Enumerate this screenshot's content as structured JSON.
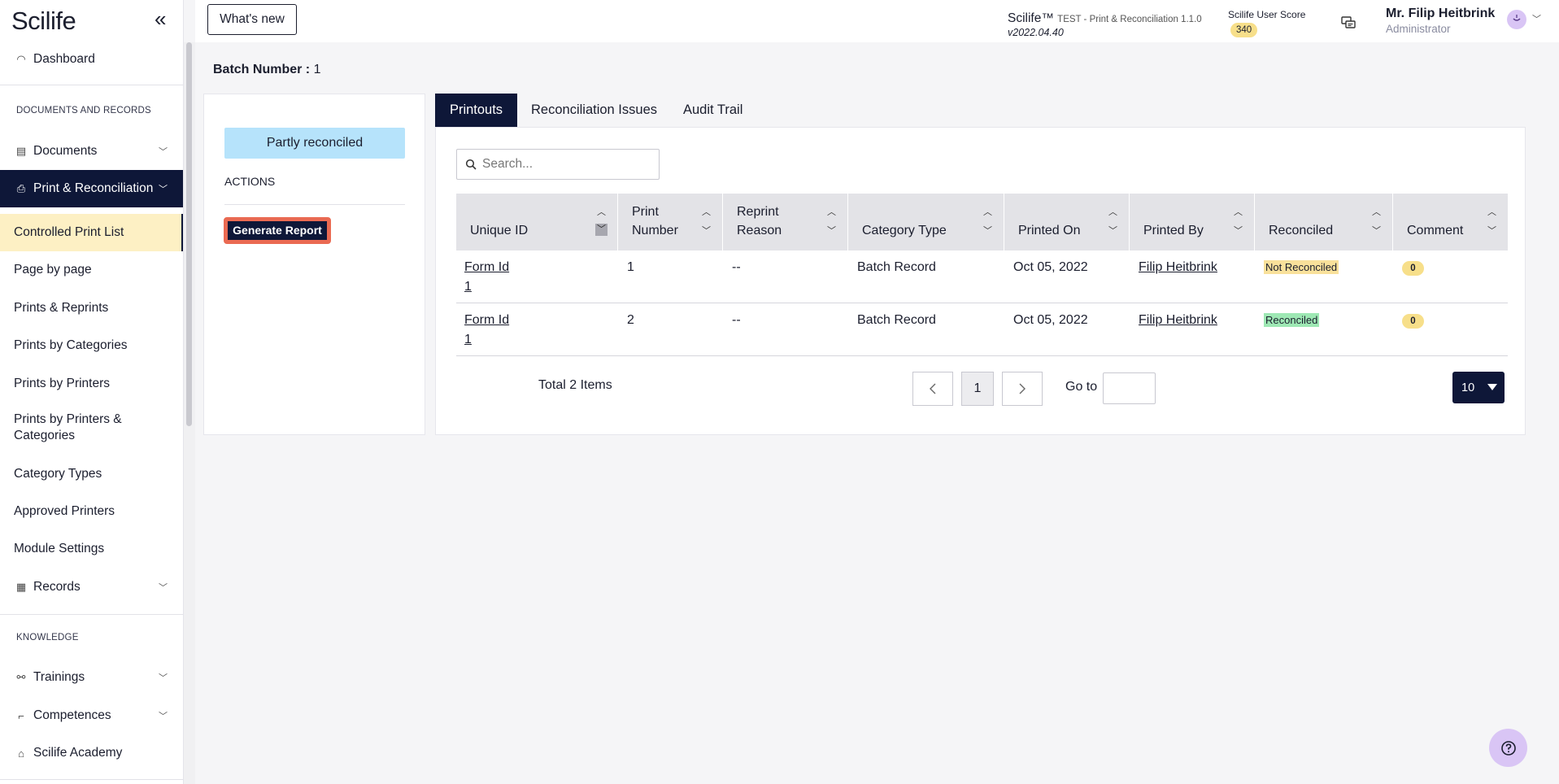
{
  "sidebar": {
    "logo": "Scilife",
    "collapse_icon": "double-chevron-left-icon",
    "dashboard": "Dashboard",
    "section_docs": "DOCUMENTS AND RECORDS",
    "documents": "Documents",
    "print_reconciliation": "Print & Reconciliation",
    "sub_items": [
      "Controlled Print List",
      "Page by page",
      "Prints & Reprints",
      "Prints by Categories",
      "Prints by Printers",
      "Prints by Printers & Categories",
      "Category Types",
      "Approved Printers",
      "Module Settings"
    ],
    "records": "Records",
    "section_knowledge": "KNOWLEDGE",
    "trainings": "Trainings",
    "competences": "Competences",
    "academy": "Scilife Academy"
  },
  "topbar": {
    "whats_new": "What's new",
    "app_name": "Scilife™",
    "app_env": "TEST - Print & Reconciliation 1.1.0",
    "app_version": "v2022.04.40",
    "score_label": "Scilife User Score",
    "score_value": "340",
    "user_name": "Mr. Filip Heitbrink",
    "user_role": "Administrator"
  },
  "main": {
    "batch_label": "Batch Number :",
    "batch_value": "1",
    "status": "Partly reconciled",
    "actions_label": "ACTIONS",
    "generate_report": "Generate Report",
    "tabs": [
      "Printouts",
      "Reconciliation Issues",
      "Audit Trail"
    ],
    "search_placeholder": "Search...",
    "columns": [
      "Unique ID",
      "Print Number",
      "Reprint Reason",
      "Category Type",
      "Printed On",
      "Printed By",
      "Reconciled",
      "Comment"
    ],
    "rows": [
      {
        "unique_id": "Form Id 1",
        "print_number": "1",
        "reprint_reason": "--",
        "category_type": "Batch Record",
        "printed_on": "Oct 05, 2022",
        "printed_by": "Filip Heitbrink",
        "reconciled": "Not Reconciled",
        "comment": "0"
      },
      {
        "unique_id": "Form Id 1",
        "print_number": "2",
        "reprint_reason": "--",
        "category_type": "Batch Record",
        "printed_on": "Oct 05, 2022",
        "printed_by": "Filip Heitbrink",
        "reconciled": "Reconciled",
        "comment": "0"
      }
    ],
    "total": "Total 2 Items",
    "current_page": "1",
    "goto_label": "Go to",
    "per_page": "10"
  },
  "colors": {
    "navy": "#0e1738",
    "status_blue": "#b6e3fb",
    "highlight_yellow": "#fdf0c4",
    "warn_tag": "#f9e19b",
    "ok_tag": "#9ee8b4",
    "focus_outline": "#ea6a52"
  }
}
